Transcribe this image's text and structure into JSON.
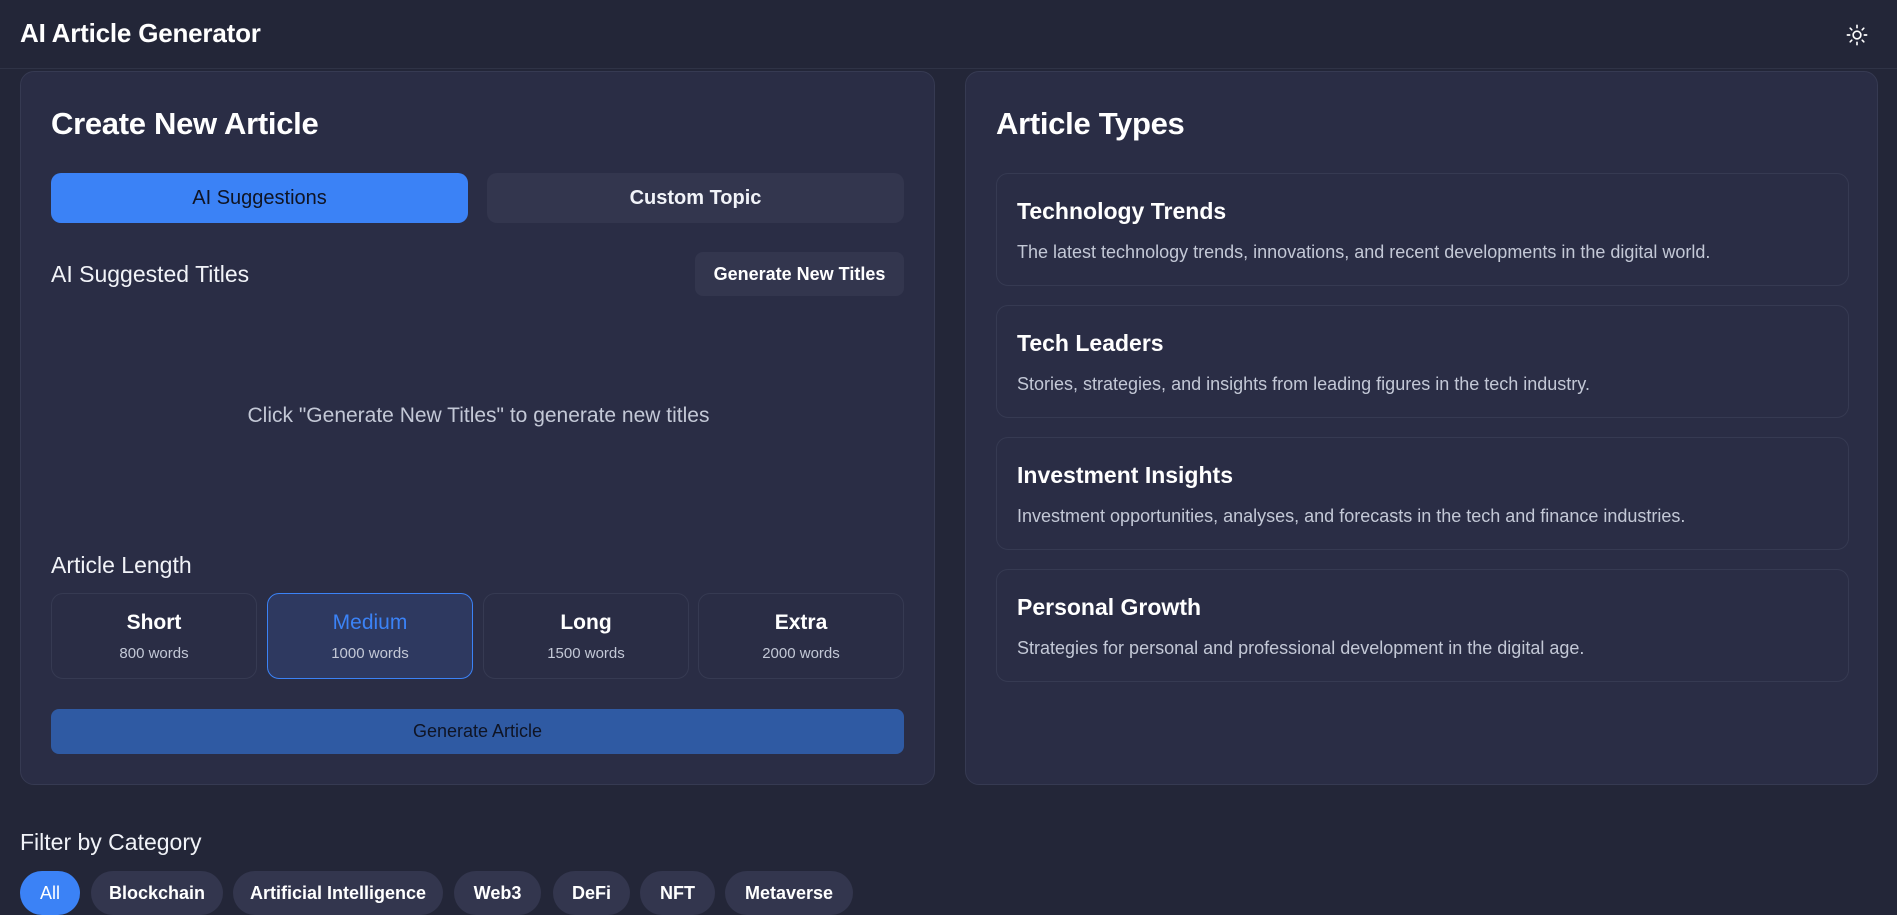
{
  "header": {
    "title": "AI Article Generator",
    "theme_icon": "sun-icon"
  },
  "create": {
    "title": "Create New Article",
    "tabs": [
      {
        "label": "AI Suggestions",
        "active": true
      },
      {
        "label": "Custom Topic",
        "active": false
      }
    ],
    "suggested_label": "AI Suggested Titles",
    "generate_titles_label": "Generate New Titles",
    "empty_hint": "Click \"Generate New Titles\" to generate new titles",
    "length_label": "Article Length",
    "lengths": [
      {
        "name": "Short",
        "words": "800 words",
        "selected": false
      },
      {
        "name": "Medium",
        "words": "1000 words",
        "selected": true
      },
      {
        "name": "Long",
        "words": "1500 words",
        "selected": false
      },
      {
        "name": "Extra",
        "words": "2000 words",
        "selected": false
      }
    ],
    "generate_article_label": "Generate Article"
  },
  "types": {
    "title": "Article Types",
    "items": [
      {
        "title": "Technology Trends",
        "desc": "The latest technology trends, innovations, and recent developments in the digital world."
      },
      {
        "title": "Tech Leaders",
        "desc": "Stories, strategies, and insights from leading figures in the tech industry."
      },
      {
        "title": "Investment Insights",
        "desc": "Investment opportunities, analyses, and forecasts in the tech and finance industries."
      },
      {
        "title": "Personal Growth",
        "desc": "Strategies for personal and professional development in the digital age."
      }
    ]
  },
  "filter": {
    "label": "Filter by Category",
    "chips": [
      {
        "label": "All",
        "active": true
      },
      {
        "label": "Blockchain",
        "active": false
      },
      {
        "label": "Artificial Intelligence",
        "active": false
      },
      {
        "label": "Web3",
        "active": false
      },
      {
        "label": "DeFi",
        "active": false
      },
      {
        "label": "NFT",
        "active": false
      },
      {
        "label": "Metaverse",
        "active": false
      }
    ]
  },
  "colors": {
    "background": "#232638",
    "card": "#2a2d45",
    "accent": "#3b82f6",
    "muted_button": "#33364e",
    "primary_disabled": "#2f5aa3"
  }
}
